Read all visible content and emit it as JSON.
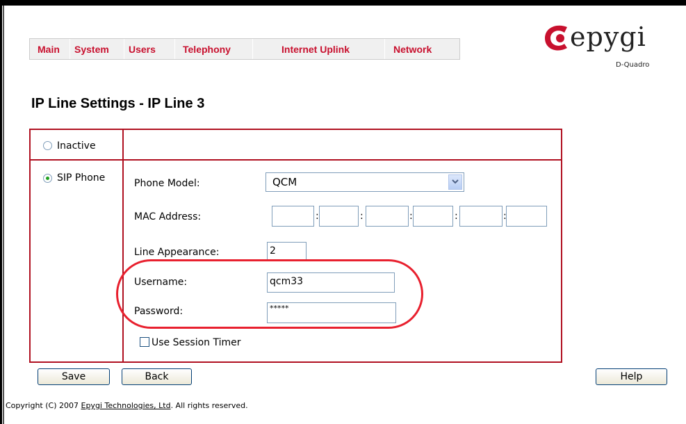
{
  "nav": {
    "items": [
      "Main",
      "System",
      "Users",
      "Telephony",
      "Internet Uplink",
      "Network"
    ]
  },
  "logo": {
    "text": "epygi",
    "subtitle": "D-Quadro"
  },
  "page": {
    "title": "IP Line Settings - IP Line 3"
  },
  "form": {
    "inactive_label": "Inactive",
    "sip_phone_label": "SIP Phone",
    "selected_mode": "SIP Phone",
    "phone_model_label": "Phone Model:",
    "phone_model_value": "QCM",
    "mac_label": "MAC Address:",
    "mac_values": [
      "",
      "",
      "",
      "",
      "",
      ""
    ],
    "line_appearance_label": "Line Appearance:",
    "line_appearance_value": "2",
    "username_label": "Username:",
    "username_value": "qcm33",
    "password_label": "Password:",
    "password_value": "*****",
    "session_timer_label": "Use Session Timer",
    "session_timer_checked": false
  },
  "buttons": {
    "save": "Save",
    "back": "Back",
    "help": "Help"
  },
  "footer": {
    "prefix": "Copyright (C) 2007 ",
    "link": "Epygi Technologies, Ltd",
    "suffix": ". All rights reserved."
  },
  "colors": {
    "nav_text": "#c8102e",
    "border": "#b01020",
    "highlight": "#e8202e"
  }
}
